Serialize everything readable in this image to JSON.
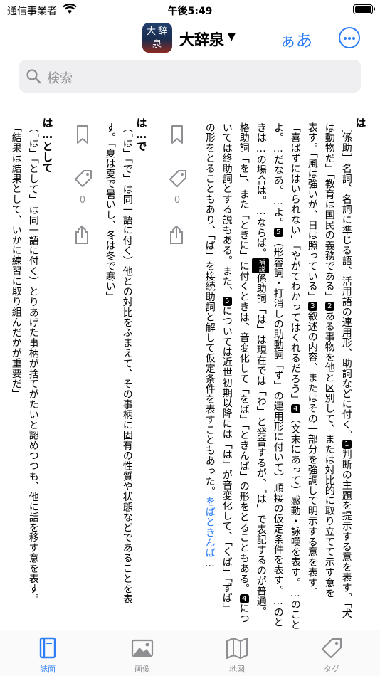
{
  "status": {
    "carrier": "通信事業者",
    "time": "午後5:49"
  },
  "nav": {
    "app_icon_chars": [
      "大",
      "辞",
      "泉"
    ],
    "title": "大辞泉",
    "caret": "▼",
    "aa_label": "ぁあ",
    "more_icon": "ellipsis-circle-icon"
  },
  "search": {
    "placeholder": "検索"
  },
  "entries": [
    {
      "headword": "は",
      "lines": [
        "［係助］名詞、名詞に準じる語、活用語の連用形、助詞などに付く。",
        "は動物だ」「教育は国民の義務である」",
        "表す。「風は強いが、日は照っている」",
        "「喜ばずにはいられない」「やがてわかってはくれるだろう」",
        "よ。…だなあ。…よ。",
        "きは…の場合は。…ならば。",
        "格助詞「を」、また「ときに」に付くときは、音変化して「をば」「ときんば」の形をとることもある。",
        "いては終助詞とする説もある。また、",
        "の形をとることもあり、「ば」を接続助詞と解して仮定条件を表すこともあった。"
      ]
    },
    {
      "headword": "は…で",
      "lines": [
        "（「は」「で」は同一語に付く）他との対比をふまえて、その事柄に固有の性質や状態などであることを表",
        "す。「夏は夏で暑いし、冬は冬で寒い」"
      ]
    },
    {
      "headword": "は…として",
      "lines": [
        "（「は」「として」は同一語に付く）とりあげた事柄が捨てがたいと認めつつも、他に話を移す意を表す。",
        "「結果は結果として、いかに練習に取り組んだかが重要だ」"
      ]
    }
  ],
  "line_extras": {
    "l1_a": "判断の主題を提示する意を表す。「犬",
    "l2_a": "ある事物を他と区別して、または対比的に取り立てて示す意を",
    "l3_a": "叙述の内容、またはその一部分を強調して明示する意を表す。",
    "l4_a": "（文末にあって）感動・詠嘆を表す。…のこと",
    "l5_a": "（形容詞・打消しの助動詞「ず」の連用形に付いて）順接の仮定条件を表す。…のと",
    "l6_tag": "補説",
    "l6_a": "係助詞「は」は現在では「わ」と発音するが、「は」で表記するのが普通。",
    "l6_b": "につ",
    "l7_a": "については近世初期以降には「は」が音変化して、「くば」「ずば」",
    "link_1": "をば",
    "link_2": "ときんば",
    "ellipsis": "…"
  },
  "nums": [
    "1",
    "2",
    "3",
    "4",
    "5",
    "4",
    "5"
  ],
  "sidebar": {
    "count_1": "0",
    "count_2": "0"
  },
  "tabs": [
    {
      "label": "誌面",
      "icon": "book-icon",
      "active": true
    },
    {
      "label": "画像",
      "icon": "photo-icon",
      "active": false
    },
    {
      "label": "地図",
      "icon": "map-icon",
      "active": false
    },
    {
      "label": "タグ",
      "icon": "tag-icon",
      "active": false
    }
  ],
  "colors": {
    "accent": "#2f7ef5",
    "gray": "#8e8e93",
    "search_bg": "#efeff1"
  }
}
